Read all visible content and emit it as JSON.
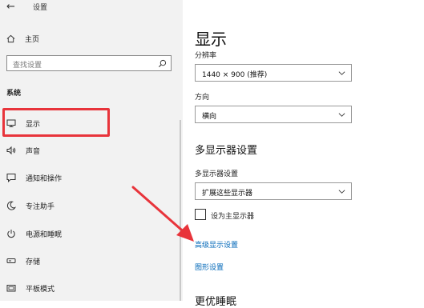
{
  "window": {
    "title": "设置"
  },
  "sidebar": {
    "home_label": "主页",
    "search_placeholder": "查找设置",
    "section_title": "系统",
    "items": [
      {
        "label": "显示",
        "icon": "monitor-icon"
      },
      {
        "label": "声音",
        "icon": "speaker-icon"
      },
      {
        "label": "通知和操作",
        "icon": "notification-icon"
      },
      {
        "label": "专注助手",
        "icon": "moon-icon"
      },
      {
        "label": "电源和睡眠",
        "icon": "power-icon"
      },
      {
        "label": "存储",
        "icon": "storage-icon"
      },
      {
        "label": "平板模式",
        "icon": "tablet-icon"
      }
    ],
    "selected_item": "显示"
  },
  "main": {
    "title": "显示",
    "resolution": {
      "label": "分辨率",
      "value": "1440 × 900 (推荐)"
    },
    "orientation": {
      "label": "方向",
      "value": "横向"
    },
    "multi_display": {
      "heading": "多显示器设置",
      "label": "多显示器设置",
      "value": "扩展这些显示器",
      "checkbox_label": "设为主显示器",
      "checkbox_checked": false
    },
    "links": {
      "advanced": "高级显示设置",
      "graphics": "图形设置"
    },
    "next_heading": "更优睡眠"
  },
  "colors": {
    "accent_link": "#0067b8",
    "annotation_red": "#e8343b",
    "sidebar_bg": "#f2f2f2"
  }
}
